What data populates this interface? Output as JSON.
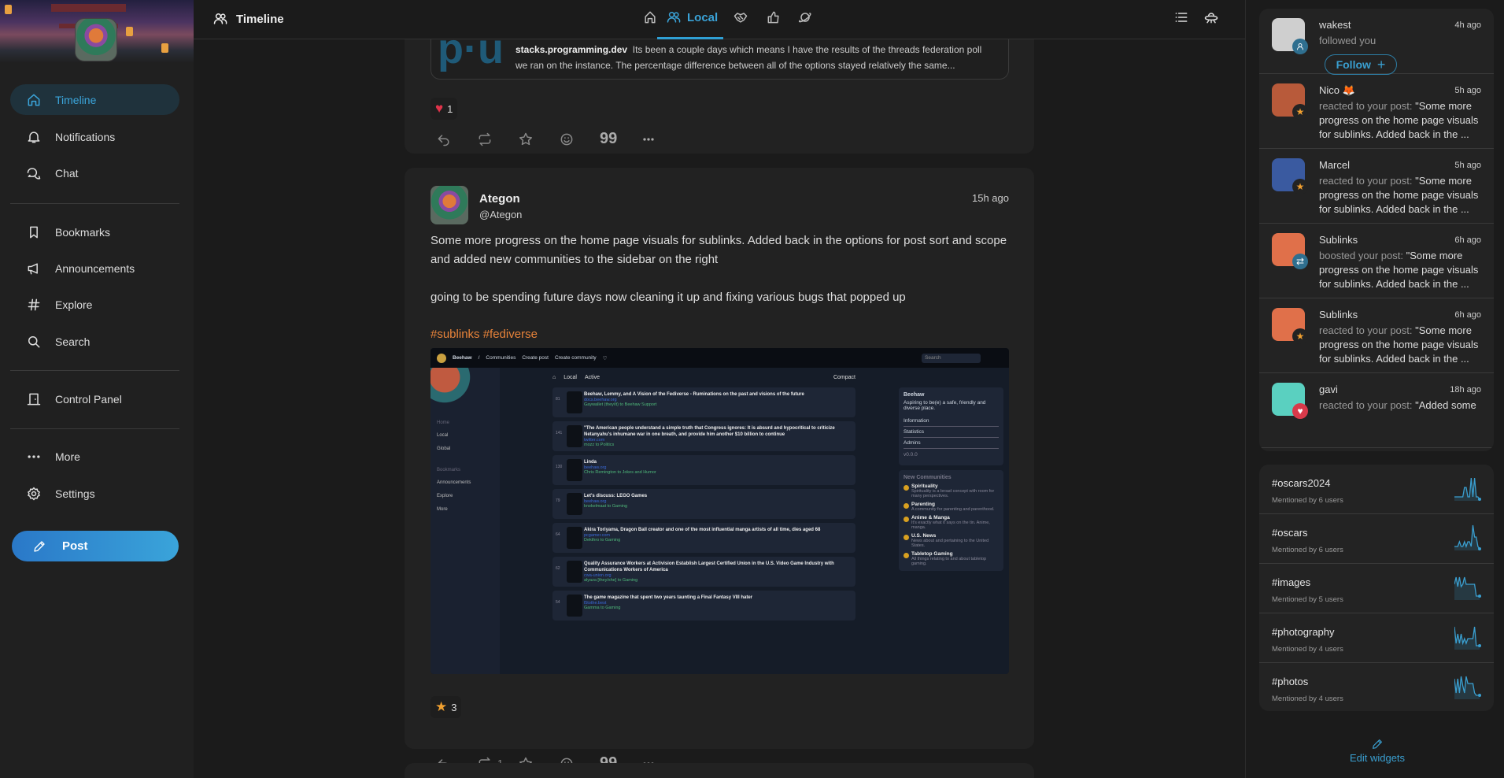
{
  "sidebar": {
    "items": [
      {
        "label": "Timeline",
        "icon": "home-icon",
        "active": true
      },
      {
        "label": "Notifications",
        "icon": "bell-icon"
      },
      {
        "label": "Chat",
        "icon": "chat-icon"
      },
      {
        "label": "Bookmarks",
        "icon": "bookmark-icon"
      },
      {
        "label": "Announcements",
        "icon": "megaphone-icon"
      },
      {
        "label": "Explore",
        "icon": "hash-icon"
      },
      {
        "label": "Search",
        "icon": "search-icon"
      },
      {
        "label": "Control Panel",
        "icon": "door-icon"
      },
      {
        "label": "More",
        "icon": "more-icon"
      },
      {
        "label": "Settings",
        "icon": "gear-icon"
      }
    ],
    "post_label": "Post"
  },
  "header": {
    "title": "Timeline",
    "tabs": [
      {
        "label": ""
      },
      {
        "label": "Local",
        "active": true
      },
      {
        "label": ""
      },
      {
        "label": ""
      },
      {
        "label": ""
      }
    ]
  },
  "posts": [
    {
      "link": {
        "domain": "stacks.programming.dev",
        "text": "Its been a couple days which means I have the results of the threads federation poll we ran on the instance. The percentage difference between all of the options stayed relatively the same...",
        "logo": "p·u"
      },
      "reaction": {
        "emoji": "heart",
        "count": "1"
      }
    },
    {
      "author": "Ategon",
      "handle": "@Ategon",
      "time": "15h ago",
      "paragraphs": [
        "Some more progress on the home page visuals for sublinks. Added back in the options for post sort and scope and added new communities to the sidebar on the right",
        "going to be spending future days now cleaning it up and fixing various bugs that popped up"
      ],
      "tags": "#sublinks #fediverse",
      "reaction": {
        "emoji": "star",
        "count": "3"
      },
      "boosts": "1",
      "image": {
        "header": [
          "Beehaw",
          "/",
          "Communities",
          "Create post",
          "Create community"
        ],
        "search": "Search",
        "side": [
          "Home",
          "Local",
          "Global",
          "Bookmarks",
          "Announcements",
          "Explore",
          "More"
        ],
        "sort": [
          "Local",
          "Active",
          "Compact"
        ],
        "items": [
          {
            "votes": "81",
            "title": "Beehaw, Lemmy, and A Vision of the Fediverse - Ruminations on the past and visions of the future",
            "url": "docs.beehaw.org",
            "meta": "Gaywallet (they/it) to Beehaw Support"
          },
          {
            "votes": "141",
            "title": "\"The American people understand a simple truth that Congress ignores: It is absurd and hypocritical to criticize Netanyahu's inhumane war in one breath, and provide him another $10 billion to continue",
            "url": "twitter.com",
            "meta": "mozz to Politics"
          },
          {
            "votes": "130",
            "title": "Linda",
            "url": "beehaw.org",
            "meta": "Chris Remington to Jokes and Humor"
          },
          {
            "votes": "79",
            "title": "Let's discuss: LEGO Games",
            "url": "beehaw.org",
            "meta": "knokelmaat to Gaming"
          },
          {
            "votes": "64",
            "title": "Akira Toriyama, Dragon Ball creator and one of the most influential manga artists of all time, dies aged 68",
            "url": "pcgamer.com",
            "meta": "Dekthro to Gaming"
          },
          {
            "votes": "62",
            "title": "Quality Assurance Workers at Activision Establish Largest Certified Union in the U.S. Video Game Industry with Communications Workers of America",
            "url": "cwa-union.org",
            "meta": "alyaza [they/she] to Gaming"
          },
          {
            "votes": "54",
            "title": "The game magazine that spent two years taunting a Final Fantasy VIII hater",
            "url": "l5tothe.best",
            "meta": "Gamma to Gaming"
          }
        ],
        "instance": {
          "name": "Beehaw",
          "desc": "Aspiring to be(e) a safe, friendly and diverse place.",
          "rows": [
            "Information",
            "Statistics",
            "Admins"
          ],
          "version": "v0.0.0"
        },
        "new_title": "New Communities",
        "communities": [
          {
            "name": "Spirituality",
            "desc": "Spirituality is a broad concept with room for many perspectives."
          },
          {
            "name": "Parenting",
            "desc": "A community for parenting and parenthood."
          },
          {
            "name": "Anime & Manga",
            "desc": "It's exactly what it says on the tin. Anime, manga."
          },
          {
            "name": "U.S. News",
            "desc": "News about and pertaining to the United States."
          },
          {
            "name": "Tabletop Gaming",
            "desc": "All things relating to and about tabletop gaming."
          }
        ]
      }
    }
  ],
  "notifications": [
    {
      "name": "wakest",
      "time": "4h ago",
      "action": "followed you",
      "excerpt": "",
      "badge": "follow",
      "follow_label": "Follow",
      "avatar": "#cfcfcf",
      "badge_color": "#2f6f8f"
    },
    {
      "name": "Nico 🦊",
      "time": "5h ago",
      "action": "reacted to your post:",
      "excerpt": " \"Some more progress on the home page visuals for sublinks. Added back in the ...",
      "badge": "★",
      "avatar": "#b85a3a",
      "badge_color": "#232323"
    },
    {
      "name": "Marcel",
      "time": "5h ago",
      "action": "reacted to your post:",
      "excerpt": " \"Some more progress on the home page visuals for sublinks. Added back in the ...",
      "badge": "★",
      "avatar": "#3a5aa0",
      "badge_color": "#232323"
    },
    {
      "name": "Sublinks",
      "time": "6h ago",
      "action": "boosted your post:",
      "excerpt": " \"Some more progress on the home page visuals for sublinks. Added back in the ...",
      "badge": "⇄",
      "avatar": "#e0704a",
      "badge_color": "#2f6f8f"
    },
    {
      "name": "Sublinks",
      "time": "6h ago",
      "action": "reacted to your post:",
      "excerpt": " \"Some more progress on the home page visuals for sublinks. Added back in the ...",
      "badge": "★",
      "avatar": "#e0704a",
      "badge_color": "#232323"
    },
    {
      "name": "gavi",
      "time": "18h ago",
      "action": "reacted to your post:",
      "excerpt": " \"Added some",
      "badge": "♥",
      "avatar": "#5ad0c0",
      "badge_color": "#d83a4a"
    }
  ],
  "trends": [
    {
      "tag": "#oscars2024",
      "count": "Mentioned by 6 users",
      "spark": [
        1,
        1,
        1,
        1,
        1,
        1,
        5,
        5,
        1,
        1,
        9,
        1,
        9,
        1,
        1,
        0
      ]
    },
    {
      "tag": "#oscars",
      "count": "Mentioned by 6 users",
      "spark": [
        1,
        1,
        1,
        3,
        1,
        1,
        3,
        1,
        3,
        3,
        1,
        10,
        5,
        5,
        1,
        0
      ]
    },
    {
      "tag": "#images",
      "count": "Mentioned by 5 users",
      "spark": [
        6,
        9,
        5,
        9,
        5,
        6,
        9,
        6,
        6,
        6,
        6,
        6,
        6,
        1,
        1,
        1
      ]
    },
    {
      "tag": "#photography",
      "count": "Mentioned by 4 users",
      "spark": [
        9,
        2,
        6,
        2,
        6,
        2,
        4,
        2,
        4,
        4,
        4,
        4,
        9,
        1,
        1,
        1
      ]
    },
    {
      "tag": "#photos",
      "count": "Mentioned by 4 users",
      "spark": [
        8,
        2,
        8,
        2,
        9,
        5,
        2,
        9,
        6,
        6,
        6,
        6,
        2,
        1,
        1,
        1
      ]
    }
  ],
  "edit_widgets": "Edit widgets",
  "colors": {
    "accent": "#3a9fd0",
    "tags": "#e8833a",
    "heart": "#e0334a",
    "star": "#f0a030"
  }
}
